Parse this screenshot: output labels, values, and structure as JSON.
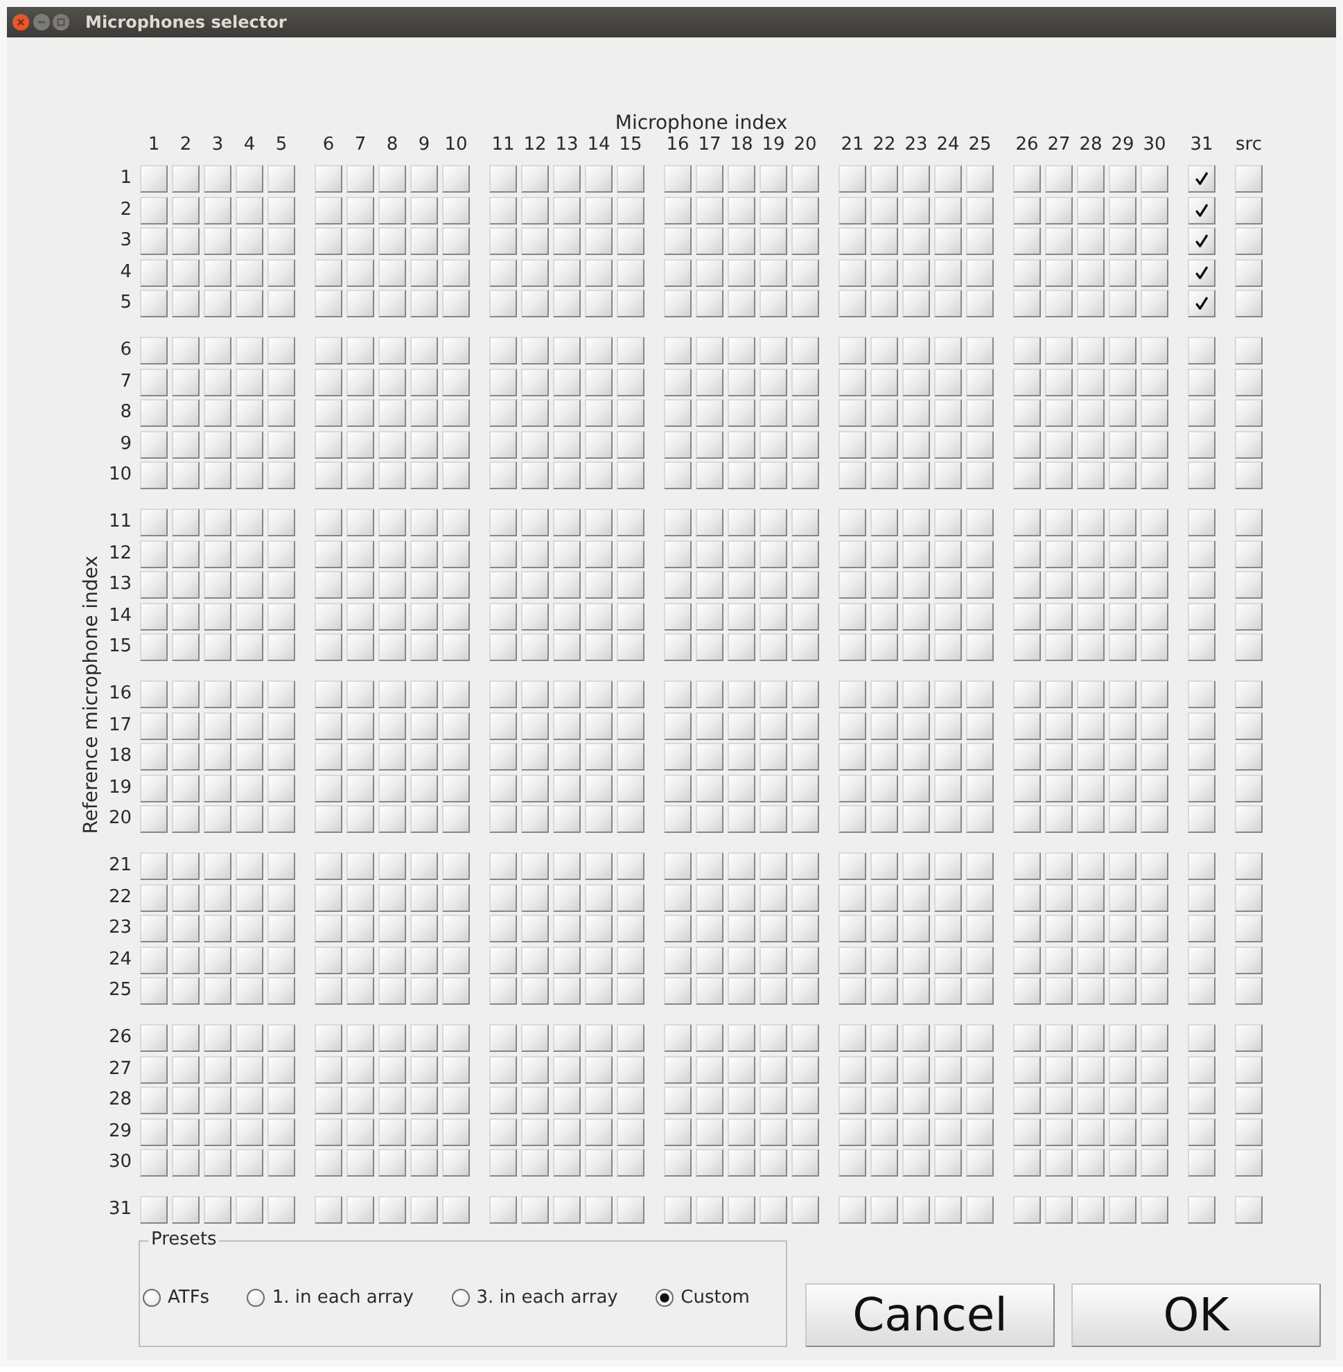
{
  "window": {
    "title": "Microphones selector"
  },
  "grid": {
    "column_axis_title": "Microphone index",
    "row_axis_title": "Reference microphone index",
    "column_groups": [
      [
        "1",
        "2",
        "3",
        "4",
        "5"
      ],
      [
        "6",
        "7",
        "8",
        "9",
        "10"
      ],
      [
        "11",
        "12",
        "13",
        "14",
        "15"
      ],
      [
        "16",
        "17",
        "18",
        "19",
        "20"
      ],
      [
        "21",
        "22",
        "23",
        "24",
        "25"
      ],
      [
        "26",
        "27",
        "28",
        "29",
        "30"
      ],
      [
        "31"
      ],
      [
        "src"
      ]
    ],
    "row_groups": [
      [
        {
          "label": "1",
          "checked": [
            false,
            false,
            false,
            false,
            false,
            false,
            false,
            false,
            false,
            false,
            false,
            false,
            false,
            false,
            false,
            false,
            false,
            false,
            false,
            false,
            false,
            false,
            false,
            false,
            false,
            false,
            false,
            false,
            false,
            false,
            true,
            false
          ]
        },
        {
          "label": "2",
          "checked": [
            false,
            false,
            false,
            false,
            false,
            false,
            false,
            false,
            false,
            false,
            false,
            false,
            false,
            false,
            false,
            false,
            false,
            false,
            false,
            false,
            false,
            false,
            false,
            false,
            false,
            false,
            false,
            false,
            false,
            false,
            true,
            false
          ]
        },
        {
          "label": "3",
          "checked": [
            false,
            false,
            false,
            false,
            false,
            false,
            false,
            false,
            false,
            false,
            false,
            false,
            false,
            false,
            false,
            false,
            false,
            false,
            false,
            false,
            false,
            false,
            false,
            false,
            false,
            false,
            false,
            false,
            false,
            false,
            true,
            false
          ]
        },
        {
          "label": "4",
          "checked": [
            false,
            false,
            false,
            false,
            false,
            false,
            false,
            false,
            false,
            false,
            false,
            false,
            false,
            false,
            false,
            false,
            false,
            false,
            false,
            false,
            false,
            false,
            false,
            false,
            false,
            false,
            false,
            false,
            false,
            false,
            true,
            false
          ]
        },
        {
          "label": "5",
          "checked": [
            false,
            false,
            false,
            false,
            false,
            false,
            false,
            false,
            false,
            false,
            false,
            false,
            false,
            false,
            false,
            false,
            false,
            false,
            false,
            false,
            false,
            false,
            false,
            false,
            false,
            false,
            false,
            false,
            false,
            false,
            true,
            false
          ]
        }
      ],
      [
        {
          "label": "6",
          "checked": [
            false,
            false,
            false,
            false,
            false,
            false,
            false,
            false,
            false,
            false,
            false,
            false,
            false,
            false,
            false,
            false,
            false,
            false,
            false,
            false,
            false,
            false,
            false,
            false,
            false,
            false,
            false,
            false,
            false,
            false,
            false,
            false
          ]
        },
        {
          "label": "7",
          "checked": [
            false,
            false,
            false,
            false,
            false,
            false,
            false,
            false,
            false,
            false,
            false,
            false,
            false,
            false,
            false,
            false,
            false,
            false,
            false,
            false,
            false,
            false,
            false,
            false,
            false,
            false,
            false,
            false,
            false,
            false,
            false,
            false
          ]
        },
        {
          "label": "8",
          "checked": [
            false,
            false,
            false,
            false,
            false,
            false,
            false,
            false,
            false,
            false,
            false,
            false,
            false,
            false,
            false,
            false,
            false,
            false,
            false,
            false,
            false,
            false,
            false,
            false,
            false,
            false,
            false,
            false,
            false,
            false,
            false,
            false
          ]
        },
        {
          "label": "9",
          "checked": [
            false,
            false,
            false,
            false,
            false,
            false,
            false,
            false,
            false,
            false,
            false,
            false,
            false,
            false,
            false,
            false,
            false,
            false,
            false,
            false,
            false,
            false,
            false,
            false,
            false,
            false,
            false,
            false,
            false,
            false,
            false,
            false
          ]
        },
        {
          "label": "10",
          "checked": [
            false,
            false,
            false,
            false,
            false,
            false,
            false,
            false,
            false,
            false,
            false,
            false,
            false,
            false,
            false,
            false,
            false,
            false,
            false,
            false,
            false,
            false,
            false,
            false,
            false,
            false,
            false,
            false,
            false,
            false,
            false,
            false
          ]
        }
      ],
      [
        {
          "label": "11",
          "checked": [
            false,
            false,
            false,
            false,
            false,
            false,
            false,
            false,
            false,
            false,
            false,
            false,
            false,
            false,
            false,
            false,
            false,
            false,
            false,
            false,
            false,
            false,
            false,
            false,
            false,
            false,
            false,
            false,
            false,
            false,
            false,
            false
          ]
        },
        {
          "label": "12",
          "checked": [
            false,
            false,
            false,
            false,
            false,
            false,
            false,
            false,
            false,
            false,
            false,
            false,
            false,
            false,
            false,
            false,
            false,
            false,
            false,
            false,
            false,
            false,
            false,
            false,
            false,
            false,
            false,
            false,
            false,
            false,
            false,
            false
          ]
        },
        {
          "label": "13",
          "checked": [
            false,
            false,
            false,
            false,
            false,
            false,
            false,
            false,
            false,
            false,
            false,
            false,
            false,
            false,
            false,
            false,
            false,
            false,
            false,
            false,
            false,
            false,
            false,
            false,
            false,
            false,
            false,
            false,
            false,
            false,
            false,
            false
          ]
        },
        {
          "label": "14",
          "checked": [
            false,
            false,
            false,
            false,
            false,
            false,
            false,
            false,
            false,
            false,
            false,
            false,
            false,
            false,
            false,
            false,
            false,
            false,
            false,
            false,
            false,
            false,
            false,
            false,
            false,
            false,
            false,
            false,
            false,
            false,
            false,
            false
          ]
        },
        {
          "label": "15",
          "checked": [
            false,
            false,
            false,
            false,
            false,
            false,
            false,
            false,
            false,
            false,
            false,
            false,
            false,
            false,
            false,
            false,
            false,
            false,
            false,
            false,
            false,
            false,
            false,
            false,
            false,
            false,
            false,
            false,
            false,
            false,
            false,
            false
          ]
        }
      ],
      [
        {
          "label": "16",
          "checked": [
            false,
            false,
            false,
            false,
            false,
            false,
            false,
            false,
            false,
            false,
            false,
            false,
            false,
            false,
            false,
            false,
            false,
            false,
            false,
            false,
            false,
            false,
            false,
            false,
            false,
            false,
            false,
            false,
            false,
            false,
            false,
            false
          ]
        },
        {
          "label": "17",
          "checked": [
            false,
            false,
            false,
            false,
            false,
            false,
            false,
            false,
            false,
            false,
            false,
            false,
            false,
            false,
            false,
            false,
            false,
            false,
            false,
            false,
            false,
            false,
            false,
            false,
            false,
            false,
            false,
            false,
            false,
            false,
            false,
            false
          ]
        },
        {
          "label": "18",
          "checked": [
            false,
            false,
            false,
            false,
            false,
            false,
            false,
            false,
            false,
            false,
            false,
            false,
            false,
            false,
            false,
            false,
            false,
            false,
            false,
            false,
            false,
            false,
            false,
            false,
            false,
            false,
            false,
            false,
            false,
            false,
            false,
            false
          ]
        },
        {
          "label": "19",
          "checked": [
            false,
            false,
            false,
            false,
            false,
            false,
            false,
            false,
            false,
            false,
            false,
            false,
            false,
            false,
            false,
            false,
            false,
            false,
            false,
            false,
            false,
            false,
            false,
            false,
            false,
            false,
            false,
            false,
            false,
            false,
            false,
            false
          ]
        },
        {
          "label": "20",
          "checked": [
            false,
            false,
            false,
            false,
            false,
            false,
            false,
            false,
            false,
            false,
            false,
            false,
            false,
            false,
            false,
            false,
            false,
            false,
            false,
            false,
            false,
            false,
            false,
            false,
            false,
            false,
            false,
            false,
            false,
            false,
            false,
            false
          ]
        }
      ],
      [
        {
          "label": "21",
          "checked": [
            false,
            false,
            false,
            false,
            false,
            false,
            false,
            false,
            false,
            false,
            false,
            false,
            false,
            false,
            false,
            false,
            false,
            false,
            false,
            false,
            false,
            false,
            false,
            false,
            false,
            false,
            false,
            false,
            false,
            false,
            false,
            false
          ]
        },
        {
          "label": "22",
          "checked": [
            false,
            false,
            false,
            false,
            false,
            false,
            false,
            false,
            false,
            false,
            false,
            false,
            false,
            false,
            false,
            false,
            false,
            false,
            false,
            false,
            false,
            false,
            false,
            false,
            false,
            false,
            false,
            false,
            false,
            false,
            false,
            false
          ]
        },
        {
          "label": "23",
          "checked": [
            false,
            false,
            false,
            false,
            false,
            false,
            false,
            false,
            false,
            false,
            false,
            false,
            false,
            false,
            false,
            false,
            false,
            false,
            false,
            false,
            false,
            false,
            false,
            false,
            false,
            false,
            false,
            false,
            false,
            false,
            false,
            false
          ]
        },
        {
          "label": "24",
          "checked": [
            false,
            false,
            false,
            false,
            false,
            false,
            false,
            false,
            false,
            false,
            false,
            false,
            false,
            false,
            false,
            false,
            false,
            false,
            false,
            false,
            false,
            false,
            false,
            false,
            false,
            false,
            false,
            false,
            false,
            false,
            false,
            false
          ]
        },
        {
          "label": "25",
          "checked": [
            false,
            false,
            false,
            false,
            false,
            false,
            false,
            false,
            false,
            false,
            false,
            false,
            false,
            false,
            false,
            false,
            false,
            false,
            false,
            false,
            false,
            false,
            false,
            false,
            false,
            false,
            false,
            false,
            false,
            false,
            false,
            false
          ]
        }
      ],
      [
        {
          "label": "26",
          "checked": [
            false,
            false,
            false,
            false,
            false,
            false,
            false,
            false,
            false,
            false,
            false,
            false,
            false,
            false,
            false,
            false,
            false,
            false,
            false,
            false,
            false,
            false,
            false,
            false,
            false,
            false,
            false,
            false,
            false,
            false,
            false,
            false
          ]
        },
        {
          "label": "27",
          "checked": [
            false,
            false,
            false,
            false,
            false,
            false,
            false,
            false,
            false,
            false,
            false,
            false,
            false,
            false,
            false,
            false,
            false,
            false,
            false,
            false,
            false,
            false,
            false,
            false,
            false,
            false,
            false,
            false,
            false,
            false,
            false,
            false
          ]
        },
        {
          "label": "28",
          "checked": [
            false,
            false,
            false,
            false,
            false,
            false,
            false,
            false,
            false,
            false,
            false,
            false,
            false,
            false,
            false,
            false,
            false,
            false,
            false,
            false,
            false,
            false,
            false,
            false,
            false,
            false,
            false,
            false,
            false,
            false,
            false,
            false
          ]
        },
        {
          "label": "29",
          "checked": [
            false,
            false,
            false,
            false,
            false,
            false,
            false,
            false,
            false,
            false,
            false,
            false,
            false,
            false,
            false,
            false,
            false,
            false,
            false,
            false,
            false,
            false,
            false,
            false,
            false,
            false,
            false,
            false,
            false,
            false,
            false,
            false
          ]
        },
        {
          "label": "30",
          "checked": [
            false,
            false,
            false,
            false,
            false,
            false,
            false,
            false,
            false,
            false,
            false,
            false,
            false,
            false,
            false,
            false,
            false,
            false,
            false,
            false,
            false,
            false,
            false,
            false,
            false,
            false,
            false,
            false,
            false,
            false,
            false,
            false
          ]
        }
      ],
      [
        {
          "label": "31",
          "checked": [
            false,
            false,
            false,
            false,
            false,
            false,
            false,
            false,
            false,
            false,
            false,
            false,
            false,
            false,
            false,
            false,
            false,
            false,
            false,
            false,
            false,
            false,
            false,
            false,
            false,
            false,
            false,
            false,
            false,
            false,
            false,
            false
          ]
        }
      ]
    ]
  },
  "presets": {
    "title": "Presets",
    "options": [
      {
        "label": "ATFs",
        "selected": false
      },
      {
        "label": "1. in each array",
        "selected": false
      },
      {
        "label": "3. in each array",
        "selected": false
      },
      {
        "label": "Custom",
        "selected": true
      }
    ]
  },
  "buttons": [
    {
      "label": "Cancel"
    },
    {
      "label": "OK"
    }
  ]
}
